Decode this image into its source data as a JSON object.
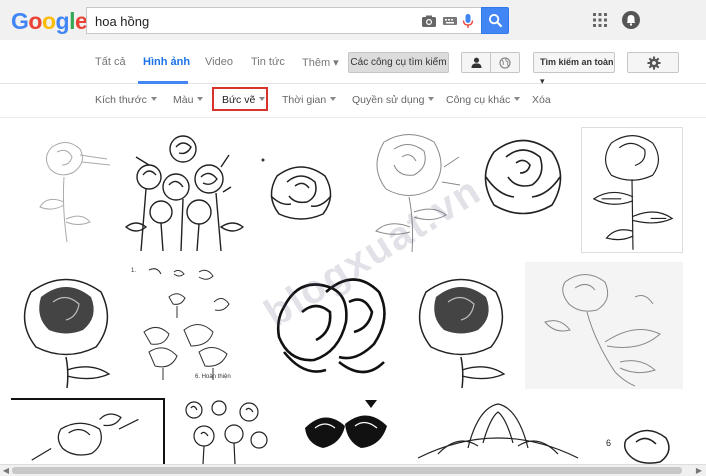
{
  "logo": {
    "letters": [
      "G",
      "o",
      "o",
      "g",
      "l",
      "e"
    ],
    "colors": [
      "#4285f4",
      "#ea4335",
      "#fbbc05",
      "#4285f4",
      "#34a853",
      "#ea4335"
    ]
  },
  "search": {
    "value": "hoa hồng",
    "placeholder": ""
  },
  "tabs": [
    {
      "label": "Tất cả"
    },
    {
      "label": "Hình ảnh"
    },
    {
      "label": "Video"
    },
    {
      "label": "Tin tức"
    },
    {
      "label": "Thêm ▾"
    }
  ],
  "tools_label": "Các công cụ tìm kiếm",
  "safe_search_label": "Tìm kiếm an toàn ▾",
  "filters": [
    {
      "label": "Kích thước"
    },
    {
      "label": "Màu"
    },
    {
      "label": "Bức vẽ"
    },
    {
      "label": "Thời gian"
    },
    {
      "label": "Quyền sử dụng"
    },
    {
      "label": "Công cụ khác"
    },
    {
      "label": "Xóa"
    }
  ],
  "thumb_captions": {
    "step_number": "6",
    "step_label": "6. Hoàn thiện"
  },
  "watermark": "blogxuat.vn",
  "icons": [
    "camera-icon",
    "keyboard-icon",
    "microphone-icon",
    "search-icon",
    "apps-icon",
    "notifications-icon",
    "person-icon",
    "globe-icon",
    "gear-icon"
  ],
  "colors": {
    "accent": "#4285f4",
    "highlight": "#d9342b"
  }
}
